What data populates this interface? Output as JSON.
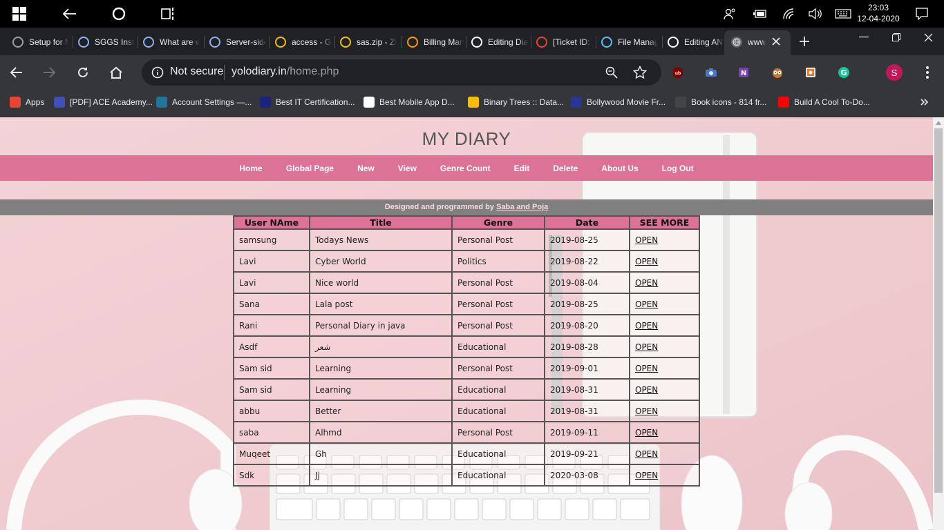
{
  "taskbar": {
    "time": "23:03",
    "date": "12-04-2020"
  },
  "tabs": [
    {
      "title": "Setup for New Accounts",
      "icon": "chrome-icon",
      "color": "#9aa0a6"
    },
    {
      "title": "SGGS Institute",
      "icon": "link-icon",
      "color": "#8ab4f8"
    },
    {
      "title": "What are web",
      "icon": "link-icon",
      "color": "#8ab4f8"
    },
    {
      "title": "Server-side",
      "icon": "link-icon",
      "color": "#8ab4f8"
    },
    {
      "title": "access - Google Drive",
      "icon": "drive-icon",
      "color": "#fbbc04"
    },
    {
      "title": "sas.zip - Zip",
      "icon": "zip-icon",
      "color": "#f4c20d"
    },
    {
      "title": "Billing Management",
      "icon": "aws-icon",
      "color": "#ff9900"
    },
    {
      "title": "Editing Diary",
      "icon": "github-icon",
      "color": "#ffffff"
    },
    {
      "title": "[Ticket ID: ]",
      "icon": "gmail-icon",
      "color": "#ea4335"
    },
    {
      "title": "File Manager",
      "icon": "file-manager-icon",
      "color": "#4fc3f7"
    },
    {
      "title": "Editing ANNOT",
      "icon": "github-icon",
      "color": "#ffffff"
    }
  ],
  "active_tab": {
    "title": "www"
  },
  "address_bar": {
    "security": "Not secure",
    "host": "yolodiary.in",
    "path": "/home.php"
  },
  "profile_initial": "S",
  "bookmarks": [
    {
      "label": "Apps",
      "icon": "apps-grid-icon",
      "color": "#ea4335"
    },
    {
      "label": "[PDF] ACE Academy...",
      "icon": "pdf-icon",
      "color": "#3f51b5"
    },
    {
      "label": "Account Settings —...",
      "icon": "wordpress-icon",
      "color": "#21759b"
    },
    {
      "label": "Best IT Certification...",
      "icon": "cert-icon",
      "color": "#1a237e"
    },
    {
      "label": "Best Mobile App D...",
      "icon": "b-icon",
      "color": "#ffffff"
    },
    {
      "label": "Binary Trees :: Data...",
      "icon": "binary-icon",
      "color": "#fbbc04"
    },
    {
      "label": "Bollywood Movie Fr...",
      "icon": "movie-icon",
      "color": "#283593"
    },
    {
      "label": "Book icons - 814 fr...",
      "icon": "book-icon",
      "color": "#444444"
    },
    {
      "label": "Build A Cool To-Do...",
      "icon": "youtube-icon",
      "color": "#ff0000"
    }
  ],
  "site": {
    "title": "MY DIARY",
    "nav": [
      "Home",
      "Global Page",
      "New",
      "View",
      "Genre Count",
      "Edit",
      "Delete",
      "About Us",
      "Log Out"
    ],
    "credit_prefix": "Designed and programmed by ",
    "credit_link": "Saba and Poja",
    "colors": {
      "accent": "#dc7295",
      "page_bg": "#f1cfd3",
      "credit_bar": "#808080"
    }
  },
  "table": {
    "headers": [
      "User NAme",
      "Title",
      "Genre",
      "Date",
      "SEE MORE"
    ],
    "rows": [
      [
        "samsung",
        "Todays News",
        "Personal Post",
        "2019-08-25",
        "OPEN"
      ],
      [
        "Lavi",
        "Cyber World",
        "Politics",
        "2019-08-22",
        "OPEN"
      ],
      [
        "Lavi",
        "Nice world",
        "Personal Post",
        "2019-08-04",
        "OPEN"
      ],
      [
        "Sana",
        "Lala post",
        "Personal Post",
        "2019-08-25",
        "OPEN"
      ],
      [
        "Rani",
        "Personal Diary in java",
        "Personal Post",
        "2019-08-20",
        "OPEN"
      ],
      [
        "Asdf",
        "شعر",
        "Educational",
        "2019-08-28",
        "OPEN"
      ],
      [
        "Sam sid",
        "Learning",
        "Personal Post",
        "2019-09-01",
        "OPEN"
      ],
      [
        "Sam sid",
        "Learning",
        "Educational",
        "2019-08-31",
        "OPEN"
      ],
      [
        "abbu",
        "Better",
        "Educational",
        "2019-08-31",
        "OPEN"
      ],
      [
        "saba",
        "Alhmd",
        "Personal Post",
        "2019-09-11",
        "OPEN"
      ],
      [
        "Muqeet",
        "Gh",
        "Educational",
        "2019-09-21",
        "OPEN"
      ],
      [
        "Sdk",
        "Jj",
        "Educational",
        "2020-03-08",
        "OPEN"
      ]
    ]
  }
}
